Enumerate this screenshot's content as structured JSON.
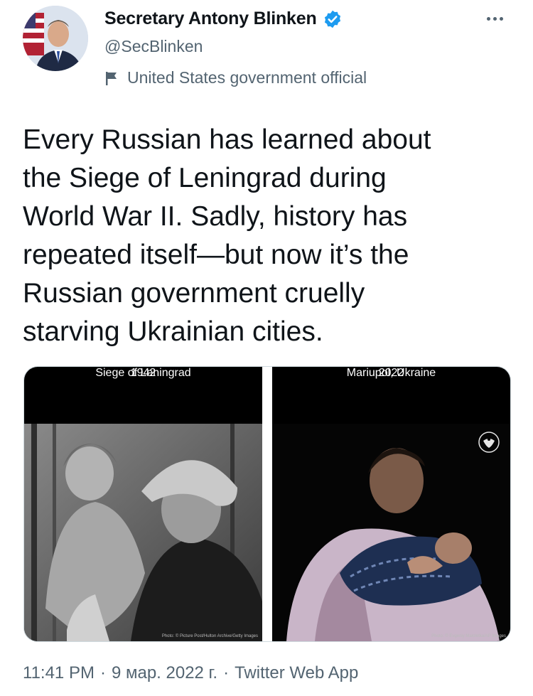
{
  "author": {
    "display_name": "Secretary Antony Blinken",
    "handle": "@SecBlinken",
    "label": "United States government official",
    "verified_icon": "verified-badge-icon",
    "label_icon": "flag-icon",
    "more_icon": "more-dots-icon"
  },
  "tweet": {
    "text": "Every Russian has learned about\nthe Siege of Leningrad during\nWorld War II. Sadly, history has\nrepeated itself—but now it’s the\nRussian government cruelly\nstarving Ukrainian cities."
  },
  "media": {
    "left": {
      "title": "Siege of Leningrad",
      "year": "1942",
      "credit": "Photo: © Picture Post/Hulton Archive/Getty Images"
    },
    "right": {
      "title": "Mariupol, Ukraine",
      "year": "2022",
      "credit": "Photo: © Evgeniy Maloletka/AP Images"
    }
  },
  "footer": {
    "time": "11:41 PM",
    "date": "9 мар. 2022 г.",
    "separator": "·",
    "source": "Twitter Web App"
  },
  "colors": {
    "verified": "#1d9bf0",
    "secondary_text": "#536471",
    "primary_text": "#0f1419"
  }
}
